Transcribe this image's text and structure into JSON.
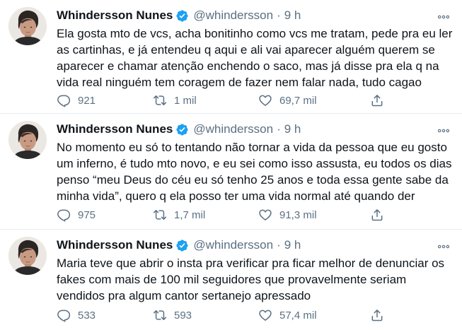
{
  "colors": {
    "text": "#0f1419",
    "secondary": "#5b7083",
    "verified": "#1da1f2",
    "divider": "#e6ecf0",
    "background": "#ffffff"
  },
  "icons": {
    "reply": "reply-icon",
    "retweet": "retweet-icon",
    "like": "heart-icon",
    "share": "share-icon",
    "more": "more-icon",
    "verified": "verified-badge-icon"
  },
  "tweets": [
    {
      "author_name": "Whindersson Nunes",
      "handle": "@whindersson",
      "separator": "·",
      "time": "9 h",
      "text": "Ela gosta mto de vcs, acha bonitinho como vcs me tratam, pede pra eu ler as cartinhas, e já entendeu q aqui e ali vai aparecer alguém querem se aparecer e chamar atenção enchendo o saco, mas já disse pra ela q na vida real ninguém tem coragem de fazer nem falar nada, tudo cagao",
      "replies": "921",
      "retweets": "1 mil",
      "likes": "69,7 mil"
    },
    {
      "author_name": "Whindersson Nunes",
      "handle": "@whindersson",
      "separator": "·",
      "time": "9 h",
      "text": "No momento eu só to tentando não tornar a vida da pessoa que eu gosto um inferno, é tudo mto novo, e eu sei como isso assusta, eu todos os dias penso “meu Deus do céu eu só tenho 25 anos e toda essa gente sabe da minha vida”, quero q ela posso ter uma vida normal até quando der",
      "replies": "975",
      "retweets": "1,7 mil",
      "likes": "91,3 mil"
    },
    {
      "author_name": "Whindersson Nunes",
      "handle": "@whindersson",
      "separator": "·",
      "time": "9 h",
      "text": "Maria teve que abrir o insta pra verificar pra ficar melhor de denunciar os fakes com mais de 100 mil seguidores que provavelmente seriam vendidos pra algum cantor sertanejo apressado",
      "replies": "533",
      "retweets": "593",
      "likes": "57,4 mil"
    }
  ]
}
